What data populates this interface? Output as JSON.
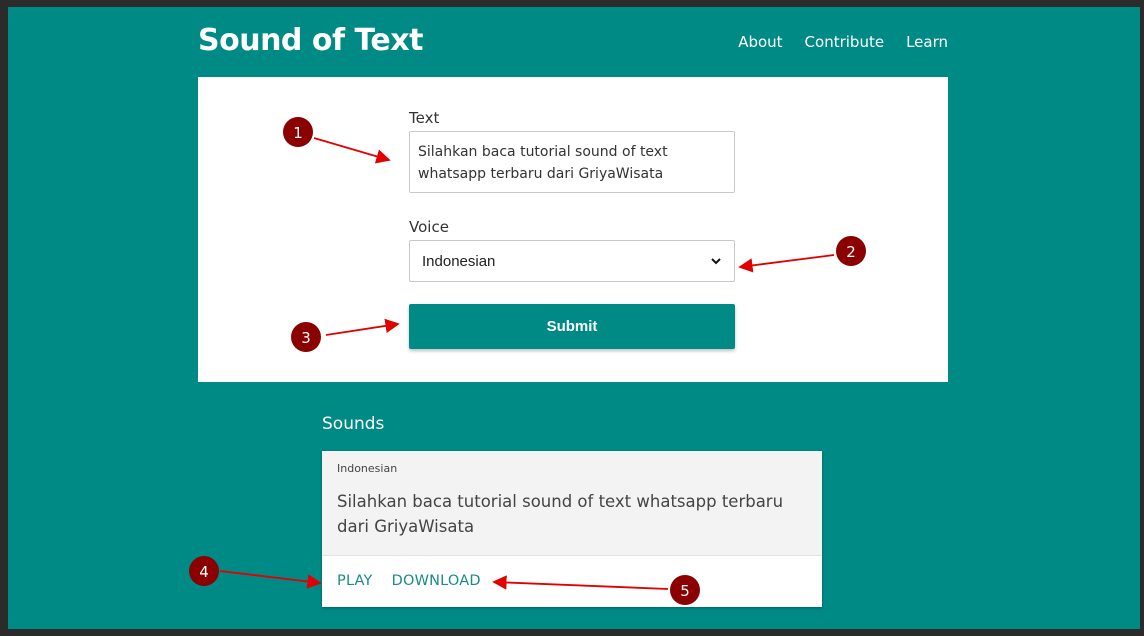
{
  "header": {
    "brand": "Sound of Text",
    "nav": [
      "About",
      "Contribute",
      "Learn"
    ]
  },
  "form": {
    "text_label": "Text",
    "text_value": "Silahkan baca tutorial sound of text whatsapp terbaru dari GriyaWisata",
    "voice_label": "Voice",
    "voice_selected": "Indonesian",
    "submit_label": "Submit"
  },
  "sounds": {
    "title": "Sounds",
    "items": [
      {
        "voice": "Indonesian",
        "text": "Silahkan baca tutorial sound of text whatsapp terbaru dari GriyaWisata",
        "play_label": "PLAY",
        "download_label": "DOWNLOAD"
      }
    ]
  },
  "annotations": [
    "1",
    "2",
    "3",
    "4",
    "5"
  ],
  "colors": {
    "theme": "#008a86",
    "annotation_marker": "#8b0000",
    "annotation_arrow": "#e00000"
  }
}
